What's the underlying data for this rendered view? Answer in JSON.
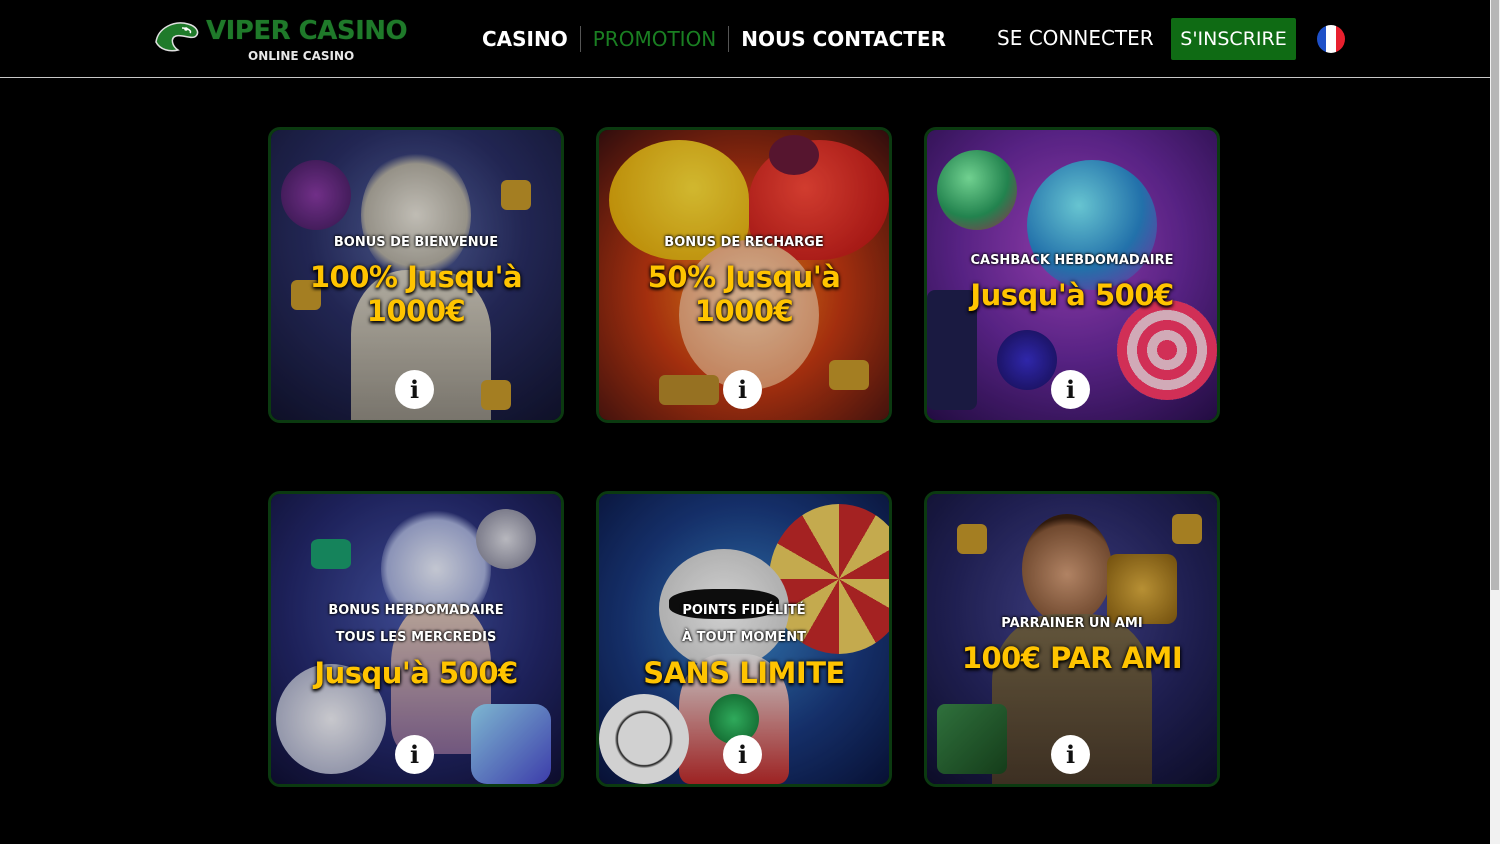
{
  "header": {
    "logo_title": "VIPER CASINO",
    "logo_subtitle": "ONLINE CASINO",
    "nav": [
      {
        "label": "CASINO",
        "active": false
      },
      {
        "label": "PROMOTION",
        "active": true
      },
      {
        "label": "NOUS CONTACTER",
        "active": false
      }
    ],
    "login_label": "SE CONNECTER",
    "signup_label": "S'INSCRIRE",
    "language_flag": "flag-fr-icon",
    "colors": {
      "brand_green": "#1a7f22",
      "signup_bg": "#0f6b14",
      "accent_gold": "#ffc400"
    }
  },
  "promotions": [
    {
      "lines": [
        "BONUS DE BIENVENUE"
      ],
      "headline": "100% Jusqu'à 1000€",
      "theme": "zeus"
    },
    {
      "lines": [
        "BONUS DE RECHARGE"
      ],
      "headline": "50% Jusqu'à 1000€",
      "theme": "jester"
    },
    {
      "lines": [
        "CASHBACK HEBDOMADAIRE"
      ],
      "headline": "Jusqu'à 500€",
      "theme": "candy"
    },
    {
      "lines": [
        "BONUS HEBDOMADAIRE",
        "TOUS LES MERCREDIS"
      ],
      "headline": "Jusqu'à 500€",
      "theme": "ice-queen"
    },
    {
      "lines": [
        "POINTS FIDÉLITÉ",
        "À TOUT MOMENT"
      ],
      "headline": "SANS LIMITE",
      "theme": "panda"
    },
    {
      "lines": [
        "PARRAINER UN AMI"
      ],
      "headline": "100€ PAR AMI",
      "theme": "explorer"
    }
  ]
}
